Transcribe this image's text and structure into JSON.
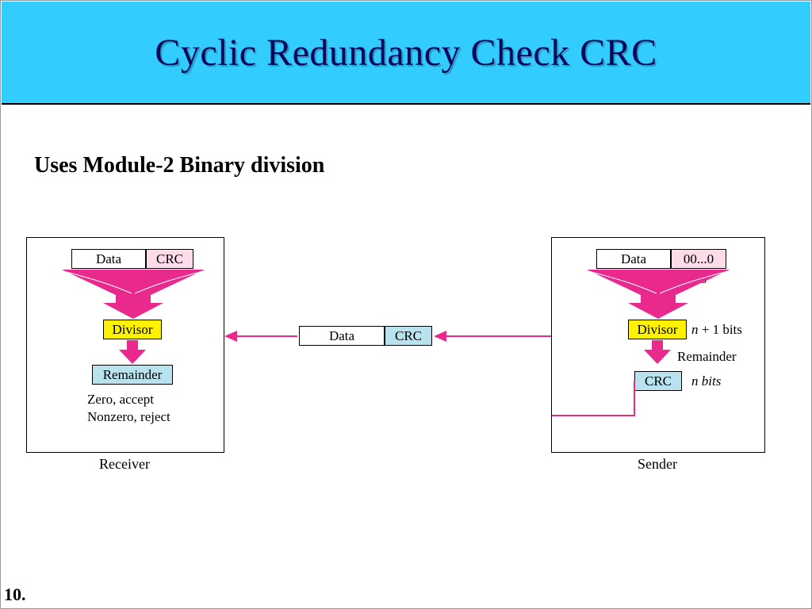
{
  "slide": {
    "title": "Cyclic Redundancy Check CRC",
    "subtitle": "Uses Module-2 Binary division",
    "page_number": "10."
  },
  "colors": {
    "titleband": "#33ccff",
    "pink": "#fddbe9",
    "yellow": "#fff200",
    "lblue": "#b9e2ef",
    "magenta": "#e92a8c"
  },
  "receiver": {
    "caption": "Receiver",
    "input_data": "Data",
    "input_crc": "CRC",
    "divisor": "Divisor",
    "remainder": "Remainder",
    "rule1": "Zero, accept",
    "rule2": "Nonzero, reject"
  },
  "middle": {
    "data": "Data",
    "crc": "CRC"
  },
  "sender": {
    "caption": "Sender",
    "input_data": "Data",
    "input_pad": "00...0",
    "pad_bits": "n bits",
    "divisor": "Divisor",
    "divisor_bits_pre": "n",
    "divisor_bits_post": " + 1 bits",
    "remainder_word": "Remainder",
    "crc": "CRC",
    "crc_bits": "n bits"
  }
}
